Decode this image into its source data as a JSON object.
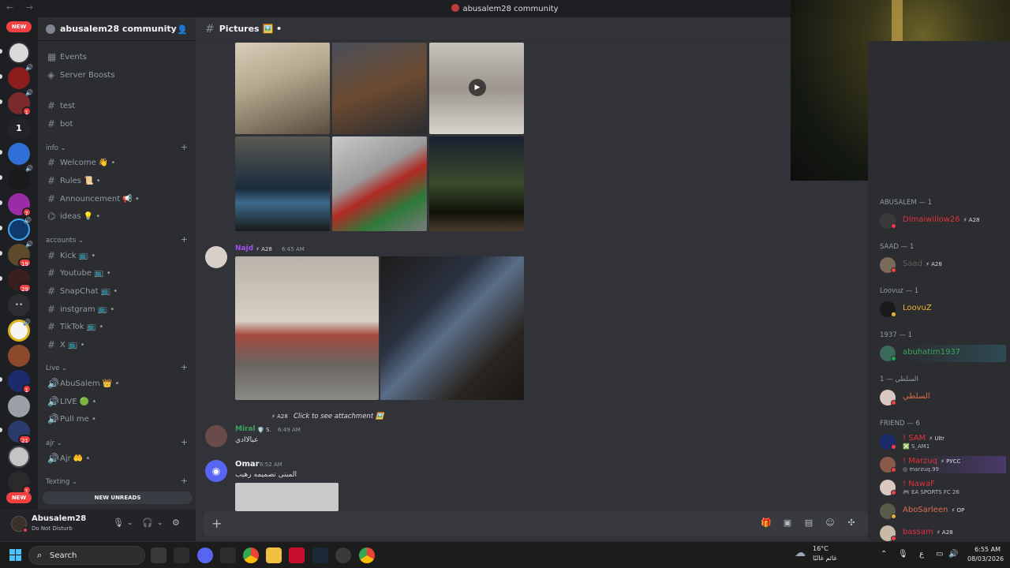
{
  "window": {
    "title": "abusalem28 community",
    "nav": "← →"
  },
  "rail": {
    "new_label": "NEW",
    "badges": [
      "1",
      "7",
      "19",
      "29",
      "1",
      "21",
      "1"
    ],
    "one_label": "1",
    "dots": "••"
  },
  "sidebar": {
    "guild_name": "abusalem28 community ⌄",
    "items": [
      {
        "label": "Events"
      },
      {
        "label": "Server Boosts"
      }
    ],
    "channels_top": [
      {
        "label": "test"
      },
      {
        "label": "bot"
      }
    ],
    "categories": {
      "info": "info ⌄",
      "accounts": "accounts ⌄",
      "live": "Live ⌄",
      "ajr": "ajr ⌄",
      "texting": "Texting ⌄"
    },
    "info_channels": [
      {
        "label": "Welcome 👋 •"
      },
      {
        "label": "Rules 📜 •"
      },
      {
        "label": "Announcement 📢 •"
      },
      {
        "label": "ideas 💡 •"
      }
    ],
    "account_channels": [
      {
        "label": "Kick 📺 •"
      },
      {
        "label": "Youtube 📺 •"
      },
      {
        "label": "SnapChat 📺 •"
      },
      {
        "label": "instgram 📺 •"
      },
      {
        "label": "TikTok 📺 •"
      },
      {
        "label": "X 📺 •"
      }
    ],
    "live_channels": [
      {
        "label": "AbuSalem 👑 •"
      },
      {
        "label": "LIVE 🟢 •"
      },
      {
        "label": "Pull me •"
      }
    ],
    "ajr_channels": [
      {
        "label": "Ajr 🤲 •"
      }
    ],
    "new_unreads": "NEW UNREADS",
    "new_label_bottom": "NEW"
  },
  "user": {
    "name": "Abusalem28",
    "status": "Do Not Disturb"
  },
  "chat": {
    "channel_name": "Pictures 🖼️ •",
    "messages": [
      {
        "author": "Najd",
        "tag": "⚡ A28",
        "time": "6:45 AM",
        "color": "#a64ef5"
      },
      {
        "reply_tag": "⚡ A28",
        "reply_text": "Click to see attachment 🖼️",
        "author": "Miral",
        "tag": "🛡️ S.",
        "time": "6:49 AM",
        "text": "عبالاادي",
        "color": "#3ba55c"
      },
      {
        "author": "Omar",
        "time": "6:52 AM",
        "text": "المبنى تصميمه رهيب",
        "color": "#f2f3f5"
      }
    ]
  },
  "members": {
    "categories": [
      {
        "label": "ABUSALEM — 1"
      },
      {
        "label": "SAAD — 1"
      },
      {
        "label": "Loovuz — 1"
      },
      {
        "label": "1937 — 1"
      },
      {
        "label": "السلطي — 1"
      },
      {
        "label": "FRIEND — 6"
      }
    ],
    "list": [
      {
        "name": "Dlmaiwillow26",
        "tag": "⚡ A28",
        "color": "#e0313d",
        "status": "#f23f42"
      },
      {
        "name": "Saad",
        "tag": "⚡ A28",
        "color": "#6b5c5a",
        "status": "#f23f42"
      },
      {
        "name": "LoovuZ",
        "tag": "",
        "color": "#f0b232",
        "status": "#f0b232"
      },
      {
        "name": "abuhatim1937",
        "tag": "",
        "color": "#3ba55c",
        "status": "#23a559"
      },
      {
        "name": "السلطي",
        "tag": "",
        "color": "#e06c4d",
        "status": "#f23f42"
      },
      {
        "name": "! SAM",
        "tag": "⚡ Ultr",
        "sub": "❎ S_AM1",
        "color": "#e0313d",
        "status": "#f23f42"
      },
      {
        "name": "! Marzuq",
        "tag": "⚡ РУСС",
        "sub": "◎ marzuq.99",
        "color": "#e0313d",
        "status": "#f23f42"
      },
      {
        "name": "! NawaF",
        "tag": "",
        "sub": "🎮 EA SPORTS FC 26",
        "color": "#e0313d",
        "status": "#f23f42"
      },
      {
        "name": "AboSarleen",
        "tag": "⚡ OP",
        "color": "#e06c4d",
        "status": "#f0b232"
      },
      {
        "name": "bassam",
        "tag": "⚡ A28",
        "color": "#e0313d",
        "status": "#f23f42"
      }
    ]
  },
  "taskbar": {
    "search": "Search",
    "temp": "16°C",
    "weather": "غائم غالبًا",
    "time": "6:55 AM",
    "date": "08/03/2026",
    "lang": "ع"
  },
  "colors": {
    "accent": "#5865f2",
    "danger": "#f23f42",
    "online": "#23a559",
    "idle": "#f0b232"
  }
}
